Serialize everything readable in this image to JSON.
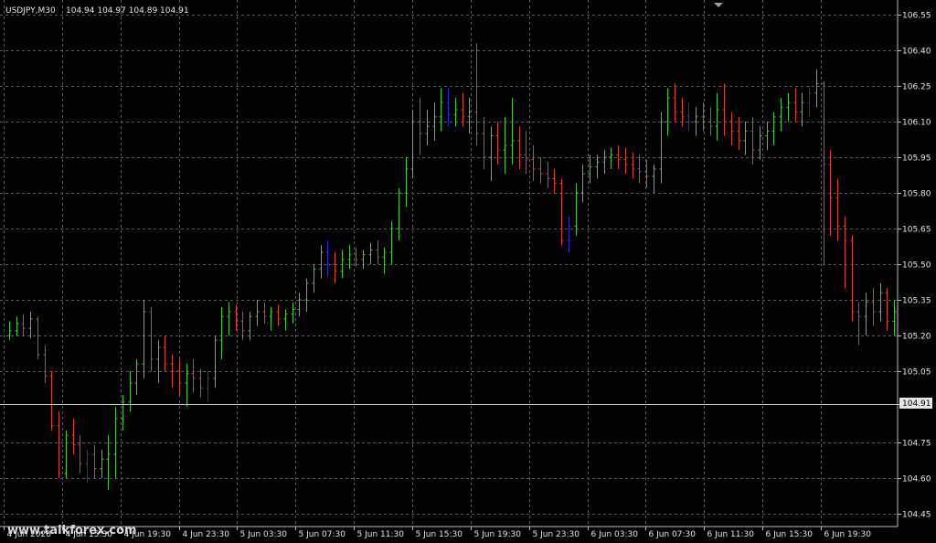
{
  "header": {
    "symbol": "USDJPY,M30",
    "ohlc": "104.94 104.97 104.89 104.91"
  },
  "current_price_label": "104.91",
  "watermark": "www.talkforex.com",
  "colors": {
    "background": "#000000",
    "grid": "#5a5a5a",
    "up_bar": "#3ccf2e",
    "down_bar": "#e0402a",
    "doji_bar": "#2a2ae0",
    "axis_text": "#e6e6e6",
    "axis_line": "#c0c0c0"
  },
  "chart_data": {
    "type": "ohlc",
    "title": "USDJPY,M30",
    "ylim": [
      104.4,
      106.6
    ],
    "grid": true,
    "y_ticks": [
      "106.55",
      "106.40",
      "106.25",
      "106.10",
      "105.95",
      "105.80",
      "105.65",
      "105.50",
      "105.35",
      "105.20",
      "105.05",
      "104.91",
      "104.75",
      "104.60",
      "104.45"
    ],
    "x_ticks": [
      "4 Jun 2020",
      "4 Jun 15:30",
      "4 Jun 19:30",
      "4 Jun 23:30",
      "5 Jun 03:30",
      "5 Jun 07:30",
      "5 Jun 11:30",
      "5 Jun 15:30",
      "5 Jun 19:30",
      "5 Jun 23:30",
      "6 Jun 03:30",
      "6 Jun 07:30",
      "6 Jun 11:30",
      "6 Jun 15:30",
      "6 Jun 19:30"
    ],
    "last_price": 104.91,
    "bar_colors": {
      "up": "up_bar",
      "down": "down_bar",
      "doji": "doji_bar"
    },
    "bars": [
      [
        105.2,
        105.26,
        105.18,
        105.22
      ],
      [
        105.22,
        105.28,
        105.2,
        105.25
      ],
      [
        105.25,
        105.29,
        105.2,
        105.23
      ],
      [
        105.23,
        105.3,
        105.19,
        105.27
      ],
      [
        105.27,
        105.28,
        105.1,
        105.12
      ],
      [
        105.12,
        105.16,
        105.0,
        105.03
      ],
      [
        105.03,
        105.05,
        104.8,
        104.82
      ],
      [
        104.82,
        104.88,
        104.6,
        104.62
      ],
      [
        104.62,
        104.8,
        104.6,
        104.78
      ],
      [
        104.78,
        104.85,
        104.7,
        104.74
      ],
      [
        104.74,
        104.78,
        104.62,
        104.66
      ],
      [
        104.66,
        104.72,
        104.58,
        104.7
      ],
      [
        104.7,
        104.74,
        104.6,
        104.64
      ],
      [
        104.64,
        104.72,
        104.6,
        104.68
      ],
      [
        104.68,
        104.78,
        104.55,
        104.7
      ],
      [
        104.7,
        104.9,
        104.6,
        104.85
      ],
      [
        104.85,
        104.95,
        104.8,
        104.92
      ],
      [
        104.92,
        105.05,
        104.88,
        105.0
      ],
      [
        105.0,
        105.1,
        104.95,
        105.08
      ],
      [
        105.08,
        105.35,
        105.02,
        105.3
      ],
      [
        105.3,
        105.32,
        105.05,
        105.1
      ],
      [
        105.1,
        105.18,
        105.0,
        105.15
      ],
      [
        105.15,
        105.2,
        105.05,
        105.08
      ],
      [
        105.08,
        105.12,
        104.98,
        105.05
      ],
      [
        105.05,
        105.1,
        104.95,
        105.0
      ],
      [
        105.0,
        105.08,
        104.9,
        105.04
      ],
      [
        105.04,
        105.1,
        104.96,
        105.02
      ],
      [
        105.02,
        105.06,
        104.94,
        104.98
      ],
      [
        104.98,
        105.05,
        104.92,
        105.02
      ],
      [
        105.02,
        105.2,
        104.98,
        105.18
      ],
      [
        105.18,
        105.32,
        105.1,
        105.28
      ],
      [
        105.28,
        105.34,
        105.2,
        105.3
      ],
      [
        105.3,
        105.33,
        105.22,
        105.26
      ],
      [
        105.26,
        105.3,
        105.18,
        105.22
      ],
      [
        105.22,
        105.3,
        105.18,
        105.28
      ],
      [
        105.28,
        105.35,
        105.24,
        105.3
      ],
      [
        105.3,
        105.34,
        105.25,
        105.28
      ],
      [
        105.28,
        105.32,
        105.22,
        105.3
      ],
      [
        105.3,
        105.33,
        105.24,
        105.27
      ],
      [
        105.27,
        105.31,
        105.22,
        105.29
      ],
      [
        105.29,
        105.34,
        105.25,
        105.31
      ],
      [
        105.31,
        105.38,
        105.28,
        105.35
      ],
      [
        105.35,
        105.44,
        105.3,
        105.42
      ],
      [
        105.42,
        105.5,
        105.38,
        105.48
      ],
      [
        105.48,
        105.58,
        105.44,
        105.55
      ],
      [
        105.55,
        105.6,
        105.45,
        105.5
      ],
      [
        105.5,
        105.55,
        105.42,
        105.47
      ],
      [
        105.47,
        105.56,
        105.44,
        105.52
      ],
      [
        105.52,
        105.58,
        105.48,
        105.54
      ],
      [
        105.54,
        105.57,
        105.49,
        105.52
      ],
      [
        105.52,
        105.56,
        105.48,
        105.54
      ],
      [
        105.54,
        105.59,
        105.5,
        105.56
      ],
      [
        105.56,
        105.6,
        105.5,
        105.53
      ],
      [
        105.53,
        105.57,
        105.46,
        105.55
      ],
      [
        105.55,
        105.68,
        105.5,
        105.65
      ],
      [
        105.65,
        105.82,
        105.6,
        105.8
      ],
      [
        105.8,
        105.95,
        105.74,
        105.9
      ],
      [
        105.9,
        106.15,
        105.86,
        106.1
      ],
      [
        106.1,
        106.2,
        105.96,
        106.05
      ],
      [
        106.05,
        106.15,
        106.0,
        106.08
      ],
      [
        106.08,
        106.18,
        106.02,
        106.12
      ],
      [
        106.12,
        106.24,
        106.06,
        106.18
      ],
      [
        106.18,
        106.24,
        106.08,
        106.13
      ],
      [
        106.13,
        106.2,
        106.08,
        106.15
      ],
      [
        106.15,
        106.22,
        106.08,
        106.12
      ],
      [
        106.12,
        106.2,
        106.05,
        106.14
      ],
      [
        106.14,
        106.43,
        106.0,
        106.05
      ],
      [
        106.05,
        106.12,
        105.9,
        105.95
      ],
      [
        105.95,
        106.08,
        105.85,
        106.04
      ],
      [
        106.04,
        106.1,
        105.92,
        105.98
      ],
      [
        105.98,
        106.12,
        105.88,
        106.0
      ],
      [
        106.0,
        106.2,
        105.92,
        106.02
      ],
      [
        106.02,
        106.08,
        105.9,
        105.96
      ],
      [
        105.96,
        106.06,
        105.88,
        105.94
      ],
      [
        105.94,
        106.0,
        105.85,
        105.9
      ],
      [
        105.9,
        105.95,
        105.84,
        105.88
      ],
      [
        105.88,
        105.93,
        105.82,
        105.86
      ],
      [
        105.86,
        105.9,
        105.8,
        105.84
      ],
      [
        105.84,
        105.86,
        105.58,
        105.6
      ],
      [
        105.6,
        105.7,
        105.55,
        105.66
      ],
      [
        105.66,
        105.84,
        105.62,
        105.8
      ],
      [
        105.8,
        105.92,
        105.76,
        105.88
      ],
      [
        105.88,
        105.96,
        105.84,
        105.91
      ],
      [
        105.91,
        105.96,
        105.86,
        105.93
      ],
      [
        105.93,
        105.98,
        105.88,
        105.95
      ],
      [
        105.95,
        105.99,
        105.9,
        105.96
      ],
      [
        105.96,
        106.0,
        105.9,
        105.94
      ],
      [
        105.94,
        105.99,
        105.88,
        105.92
      ],
      [
        105.92,
        105.97,
        105.86,
        105.9
      ],
      [
        105.9,
        105.96,
        105.84,
        105.89
      ],
      [
        105.89,
        105.94,
        105.82,
        105.87
      ],
      [
        105.87,
        105.92,
        105.8,
        105.9
      ],
      [
        105.9,
        106.14,
        105.84,
        106.1
      ],
      [
        106.1,
        106.24,
        106.04,
        106.2
      ],
      [
        106.2,
        106.26,
        106.1,
        106.14
      ],
      [
        106.14,
        106.2,
        106.08,
        106.12
      ],
      [
        106.12,
        106.18,
        106.06,
        106.1
      ],
      [
        106.1,
        106.16,
        106.04,
        106.12
      ],
      [
        106.12,
        106.18,
        106.06,
        106.1
      ],
      [
        106.1,
        106.16,
        106.04,
        106.08
      ],
      [
        106.08,
        106.22,
        106.02,
        106.15
      ],
      [
        106.15,
        106.26,
        106.04,
        106.1
      ],
      [
        106.1,
        106.14,
        106.0,
        106.06
      ],
      [
        106.06,
        106.12,
        105.98,
        106.02
      ],
      [
        106.02,
        106.1,
        105.96,
        106.06
      ],
      [
        106.06,
        106.12,
        105.92,
        105.98
      ],
      [
        105.98,
        106.08,
        105.94,
        106.04
      ],
      [
        106.04,
        106.1,
        105.98,
        106.06
      ],
      [
        106.06,
        106.14,
        106.0,
        106.12
      ],
      [
        106.12,
        106.2,
        106.06,
        106.16
      ],
      [
        106.16,
        106.22,
        106.1,
        106.18
      ],
      [
        106.18,
        106.24,
        106.1,
        106.14
      ],
      [
        106.14,
        106.22,
        106.08,
        106.18
      ],
      [
        106.18,
        106.25,
        106.12,
        106.22
      ],
      [
        106.22,
        106.32,
        106.16,
        106.26
      ],
      [
        106.26,
        106.27,
        105.5,
        105.92
      ],
      [
        105.92,
        105.98,
        105.62,
        105.78
      ],
      [
        105.78,
        105.86,
        105.6,
        105.66
      ],
      [
        105.66,
        105.7,
        105.4,
        105.6
      ],
      [
        105.6,
        105.62,
        105.26,
        105.3
      ],
      [
        105.3,
        105.34,
        105.16,
        105.28
      ],
      [
        105.28,
        105.38,
        105.2,
        105.34
      ],
      [
        105.34,
        105.4,
        105.24,
        105.3
      ],
      [
        105.3,
        105.42,
        105.26,
        105.38
      ],
      [
        105.38,
        105.4,
        105.22,
        105.26
      ],
      [
        105.26,
        105.35,
        105.2,
        105.3
      ]
    ]
  }
}
